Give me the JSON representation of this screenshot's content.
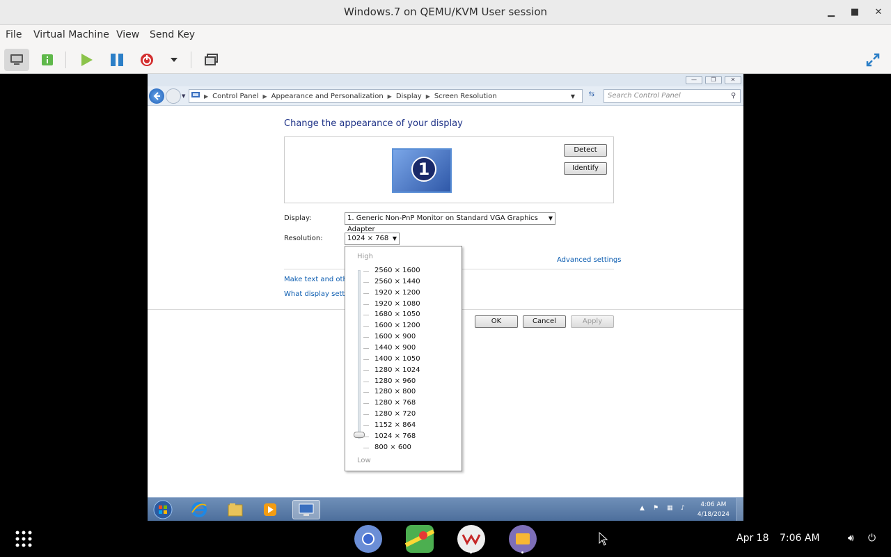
{
  "window": {
    "title": "Windows.7 on QEMU/KVM User session"
  },
  "menu": [
    "File",
    "Virtual Machine",
    "View",
    "Send Key"
  ],
  "breadcrumb": [
    "Control Panel",
    "Appearance and Personalization",
    "Display",
    "Screen Resolution"
  ],
  "search": {
    "placeholder": "Search Control Panel"
  },
  "page": {
    "heading": "Change the appearance of your display",
    "monitor_number": "1",
    "detect_label": "Detect",
    "identify_label": "Identify",
    "display_label": "Display:",
    "display_value": "1. Generic Non-PnP Monitor on Standard VGA Graphics Adapter",
    "resolution_label": "Resolution:",
    "resolution_value": "1024 × 768",
    "advanced_link": "Advanced settings",
    "link1": "Make text and other",
    "link2": "What display setting",
    "ok_label": "OK",
    "cancel_label": "Cancel",
    "apply_label": "Apply"
  },
  "dropdown": {
    "high_label": "High",
    "low_label": "Low",
    "resolutions": [
      "2560 × 1600",
      "2560 × 1440",
      "1920 × 1200",
      "1920 × 1080",
      "1680 × 1050",
      "1600 × 1200",
      "1600 × 900",
      "1440 × 900",
      "1400 × 1050",
      "1280 × 1024",
      "1280 × 960",
      "1280 × 800",
      "1280 × 768",
      "1280 × 720",
      "1152 × 864",
      "1024 × 768",
      "800 × 600"
    ],
    "selected": "1024 × 768"
  },
  "guest_taskbar": {
    "time": "4:06 AM",
    "date": "4/18/2024"
  },
  "host_dock": {
    "date": "Apr 18",
    "time": "7:06 AM"
  },
  "colors": {
    "accent": "#1e3287",
    "link": "#0b5cb0",
    "taskbar": "#5a7aa6"
  }
}
